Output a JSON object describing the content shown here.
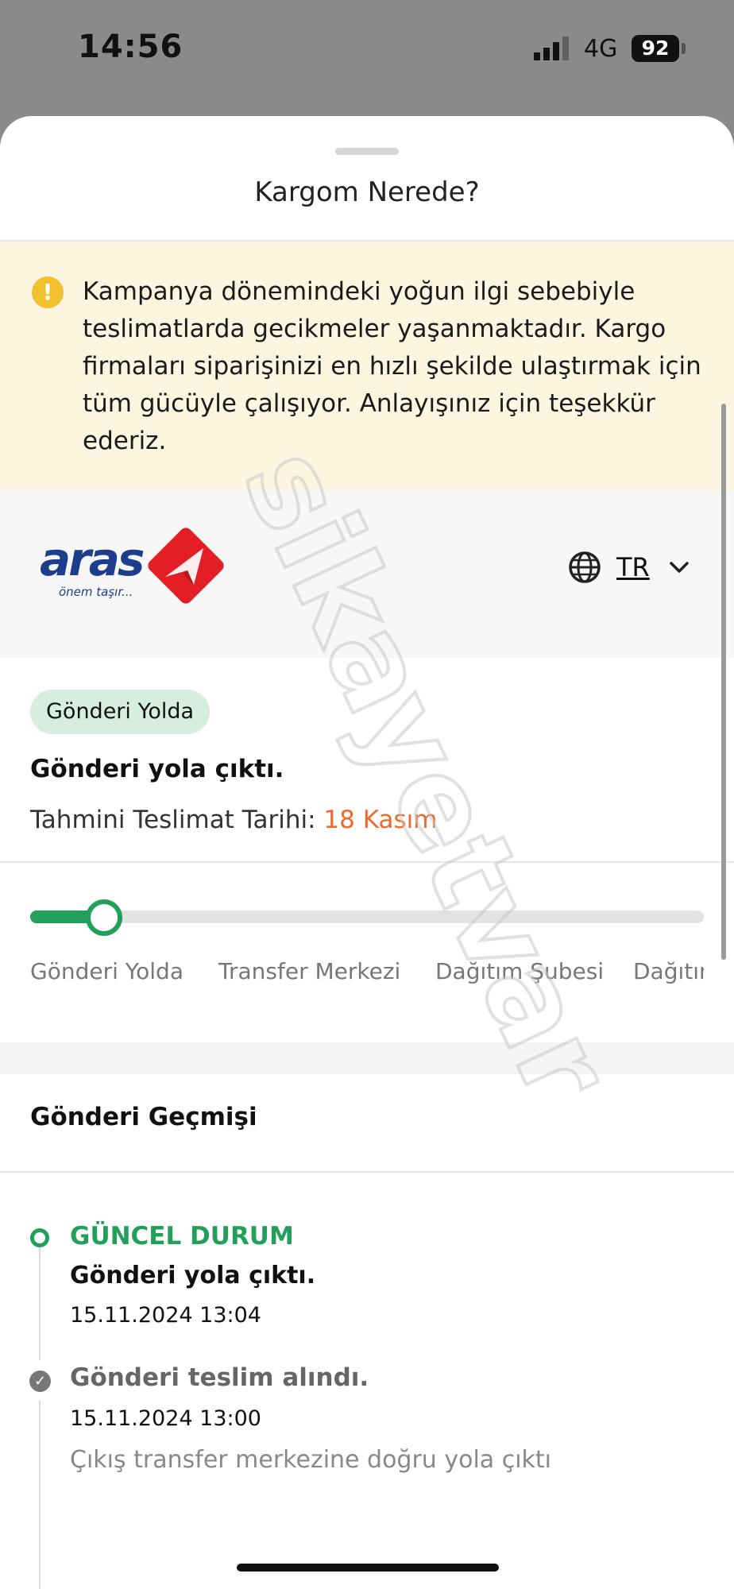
{
  "status_bar": {
    "time": "14:56",
    "network": "4G",
    "battery": "92"
  },
  "sheet": {
    "title": "Kargom Nerede?"
  },
  "notice": {
    "icon": "warning-icon",
    "text": "Kampanya dönemindeki yoğun ilgi sebebiyle teslimatlarda gecikmeler yaşanmaktadır. Kargo firmaları siparişinizi en hızlı şekilde ulaştırmak için tüm gücüyle çalışıyor. Anlayışınız için teşekkür ederiz."
  },
  "carrier": {
    "logo_text": "aras",
    "logo_tagline": "önem taşır...",
    "brand_color": "#1d3e8c",
    "mark_color": "#e31e24"
  },
  "language": {
    "icon": "globe-icon",
    "label": "TR"
  },
  "status": {
    "badge": "Gönderi Yolda",
    "title": "Gönderi yola çıktı.",
    "eta_label": "Tahmini Teslimat Tarihi:",
    "eta_date": "18 Kasım"
  },
  "progress": {
    "value": 0.11,
    "steps": [
      "Gönderi Yolda",
      "Transfer Merkezi",
      "Dağıtım Şubesi",
      "Dağıtım"
    ],
    "accent": "#22a05a"
  },
  "history": {
    "title": "Gönderi Geçmişi",
    "events": [
      {
        "header": "GÜNCEL DURUM",
        "title": "Gönderi yola çıktı.",
        "date": "15.11.2024 13:04",
        "description": ""
      },
      {
        "header": "Gönderi teslim alındı.",
        "title": "",
        "date": "15.11.2024 13:00",
        "description": "Çıkış transfer merkezine doğru yola çıktı"
      }
    ]
  },
  "watermark": "sikayetvar"
}
